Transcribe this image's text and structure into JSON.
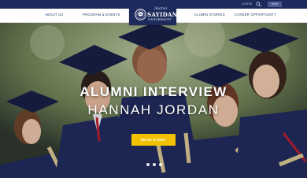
{
  "topbar": {
    "login_label": "LOGIN",
    "give_label": "GIVE",
    "search_icon": "search-icon"
  },
  "nav": {
    "left": [
      "ABOUT US",
      "PROGRAM & EVENTS"
    ],
    "right": [
      "ALUMNI STORIES",
      "CAREER OPPORTUNITY"
    ]
  },
  "logo": {
    "script": "Alumni",
    "name": "SAYIDAN",
    "sub": "UNIVERSITY"
  },
  "hero": {
    "title": "ALUMNI INTERVIEW",
    "subtitle": "HANNAH JORDAN",
    "cta_label": "READ STORY",
    "slides": 3,
    "active_slide": 1
  },
  "colors": {
    "navy": "#1d2a5c",
    "accent": "#f2c200",
    "white": "#ffffff"
  }
}
